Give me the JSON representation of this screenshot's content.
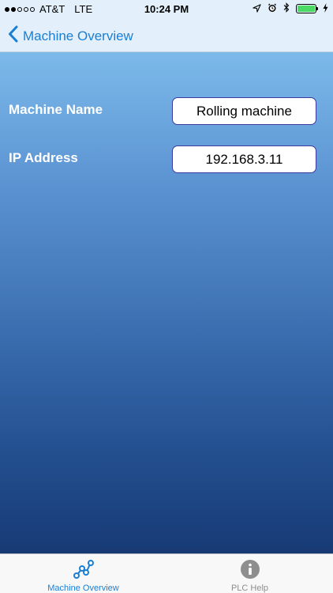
{
  "status_bar": {
    "carrier": "AT&T",
    "network": "LTE",
    "time": "10:24 PM"
  },
  "nav": {
    "back_label": "Machine Overview"
  },
  "form": {
    "machine_name_label": "Machine Name",
    "machine_name_value": "Rolling machine",
    "ip_address_label": "IP Address",
    "ip_address_value": "192.168.3.11"
  },
  "tabs": [
    {
      "label": "Machine Overview",
      "icon": "network-nodes-icon",
      "active": true
    },
    {
      "label": "PLC Help",
      "icon": "info-icon",
      "active": false
    }
  ],
  "colors": {
    "accent": "#1a7fd4",
    "field_border": "#3a3aa0",
    "battery": "#4cd964"
  }
}
